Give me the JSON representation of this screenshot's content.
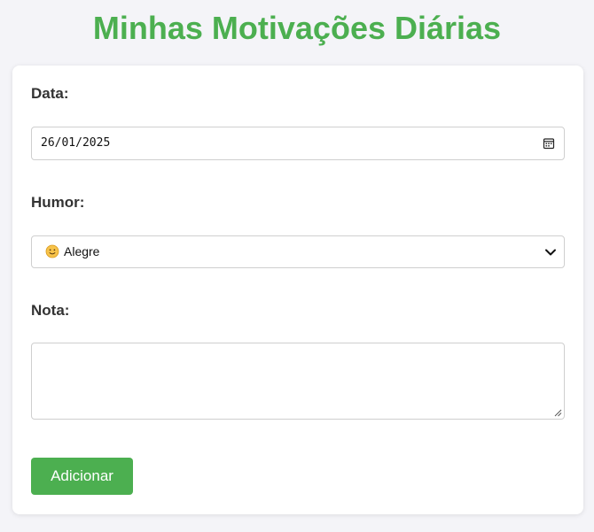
{
  "page": {
    "title": "Minhas Motivações Diárias"
  },
  "form": {
    "date_label": "Data:",
    "date_value": "26/01/2025",
    "mood_label": "Humor:",
    "mood_selected": {
      "emoji_icon": "smiling-face-emoji",
      "label": "Alegre"
    },
    "note_label": "Nota:",
    "note_value": "",
    "submit_label": "Adicionar"
  },
  "colors": {
    "accent": "#4caf50",
    "background": "#f4f4f8",
    "card": "#ffffff",
    "border": "#cfcfcf",
    "label_text": "#333333"
  }
}
